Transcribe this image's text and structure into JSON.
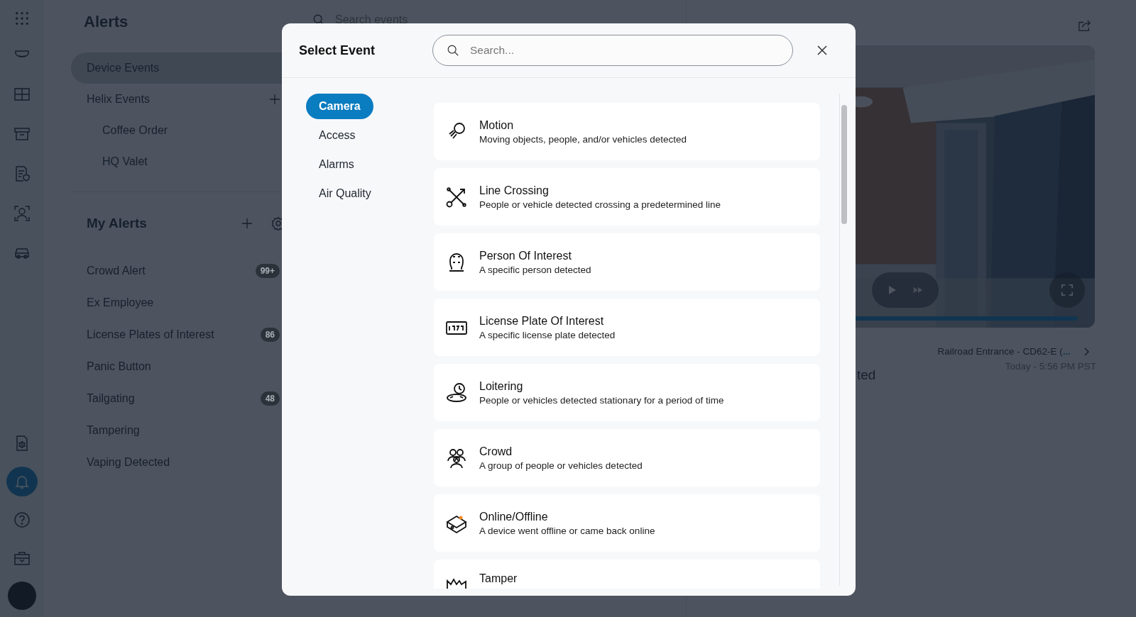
{
  "nav_rail": {
    "top_items": [
      {
        "selected": false
      },
      {
        "selected": false
      },
      {
        "selected": false
      },
      {
        "selected": false
      },
      {
        "selected": false
      },
      {
        "selected": false
      }
    ],
    "bottom_items": [
      {
        "selected": false
      },
      {
        "selected": true
      },
      {
        "selected": false
      },
      {
        "selected": false
      }
    ]
  },
  "sidebar": {
    "title": "Alerts",
    "event_groups": [
      {
        "label": "Device Events",
        "selected": true
      },
      {
        "label": "Helix Events",
        "selected": false,
        "children": [
          {
            "label": "Coffee Order",
            "selected": false
          },
          {
            "label": "HQ Valet",
            "selected": false
          }
        ]
      }
    ],
    "my_alerts": {
      "title": "My Alerts",
      "items": [
        {
          "label": "Crowd Alert",
          "count": "99+"
        },
        {
          "label": "Ex Employee"
        },
        {
          "label": "License Plates of Interest",
          "count": "86"
        },
        {
          "label": "Panic Button"
        },
        {
          "label": "Tailgating",
          "count": "48"
        },
        {
          "label": "Tampering"
        },
        {
          "label": "Vaping Detected"
        }
      ]
    }
  },
  "events_panel": {
    "search": {
      "placeholder": "Search events"
    }
  },
  "detail": {
    "title_fragment": "ted",
    "camera": "Railroad Entrance - CD62-E (",
    "camera_more": "...",
    "time": "Today - 5:56 PM PST",
    "video": {
      "kind": "picture",
      "progress": {
        "level": 0.97
      }
    }
  },
  "modal": {
    "title": "Select Event",
    "search": {
      "placeholder": "Search..."
    },
    "tabs": [
      {
        "label": "Camera",
        "selected": true
      },
      {
        "label": "Access",
        "selected": false
      },
      {
        "label": "Alarms",
        "selected": false
      },
      {
        "label": "Air Quality",
        "selected": false
      }
    ],
    "events": [
      {
        "title": "Motion",
        "description": "Moving objects, people, and/or vehicles detected"
      },
      {
        "title": "Line Crossing",
        "description": "People or vehicle detected crossing a predetermined line"
      },
      {
        "title": "Person Of Interest",
        "description": "A specific person detected"
      },
      {
        "title": "License Plate Of Interest",
        "description": "A specific license plate detected"
      },
      {
        "title": "Loitering",
        "description": "People or vehicles detected stationary for a period of time"
      },
      {
        "title": "Crowd",
        "description": "A group of people or vehicles detected"
      },
      {
        "title": "Online/Offline",
        "description": "A device went offline or came back online"
      },
      {
        "title": "Tamper"
      }
    ]
  }
}
